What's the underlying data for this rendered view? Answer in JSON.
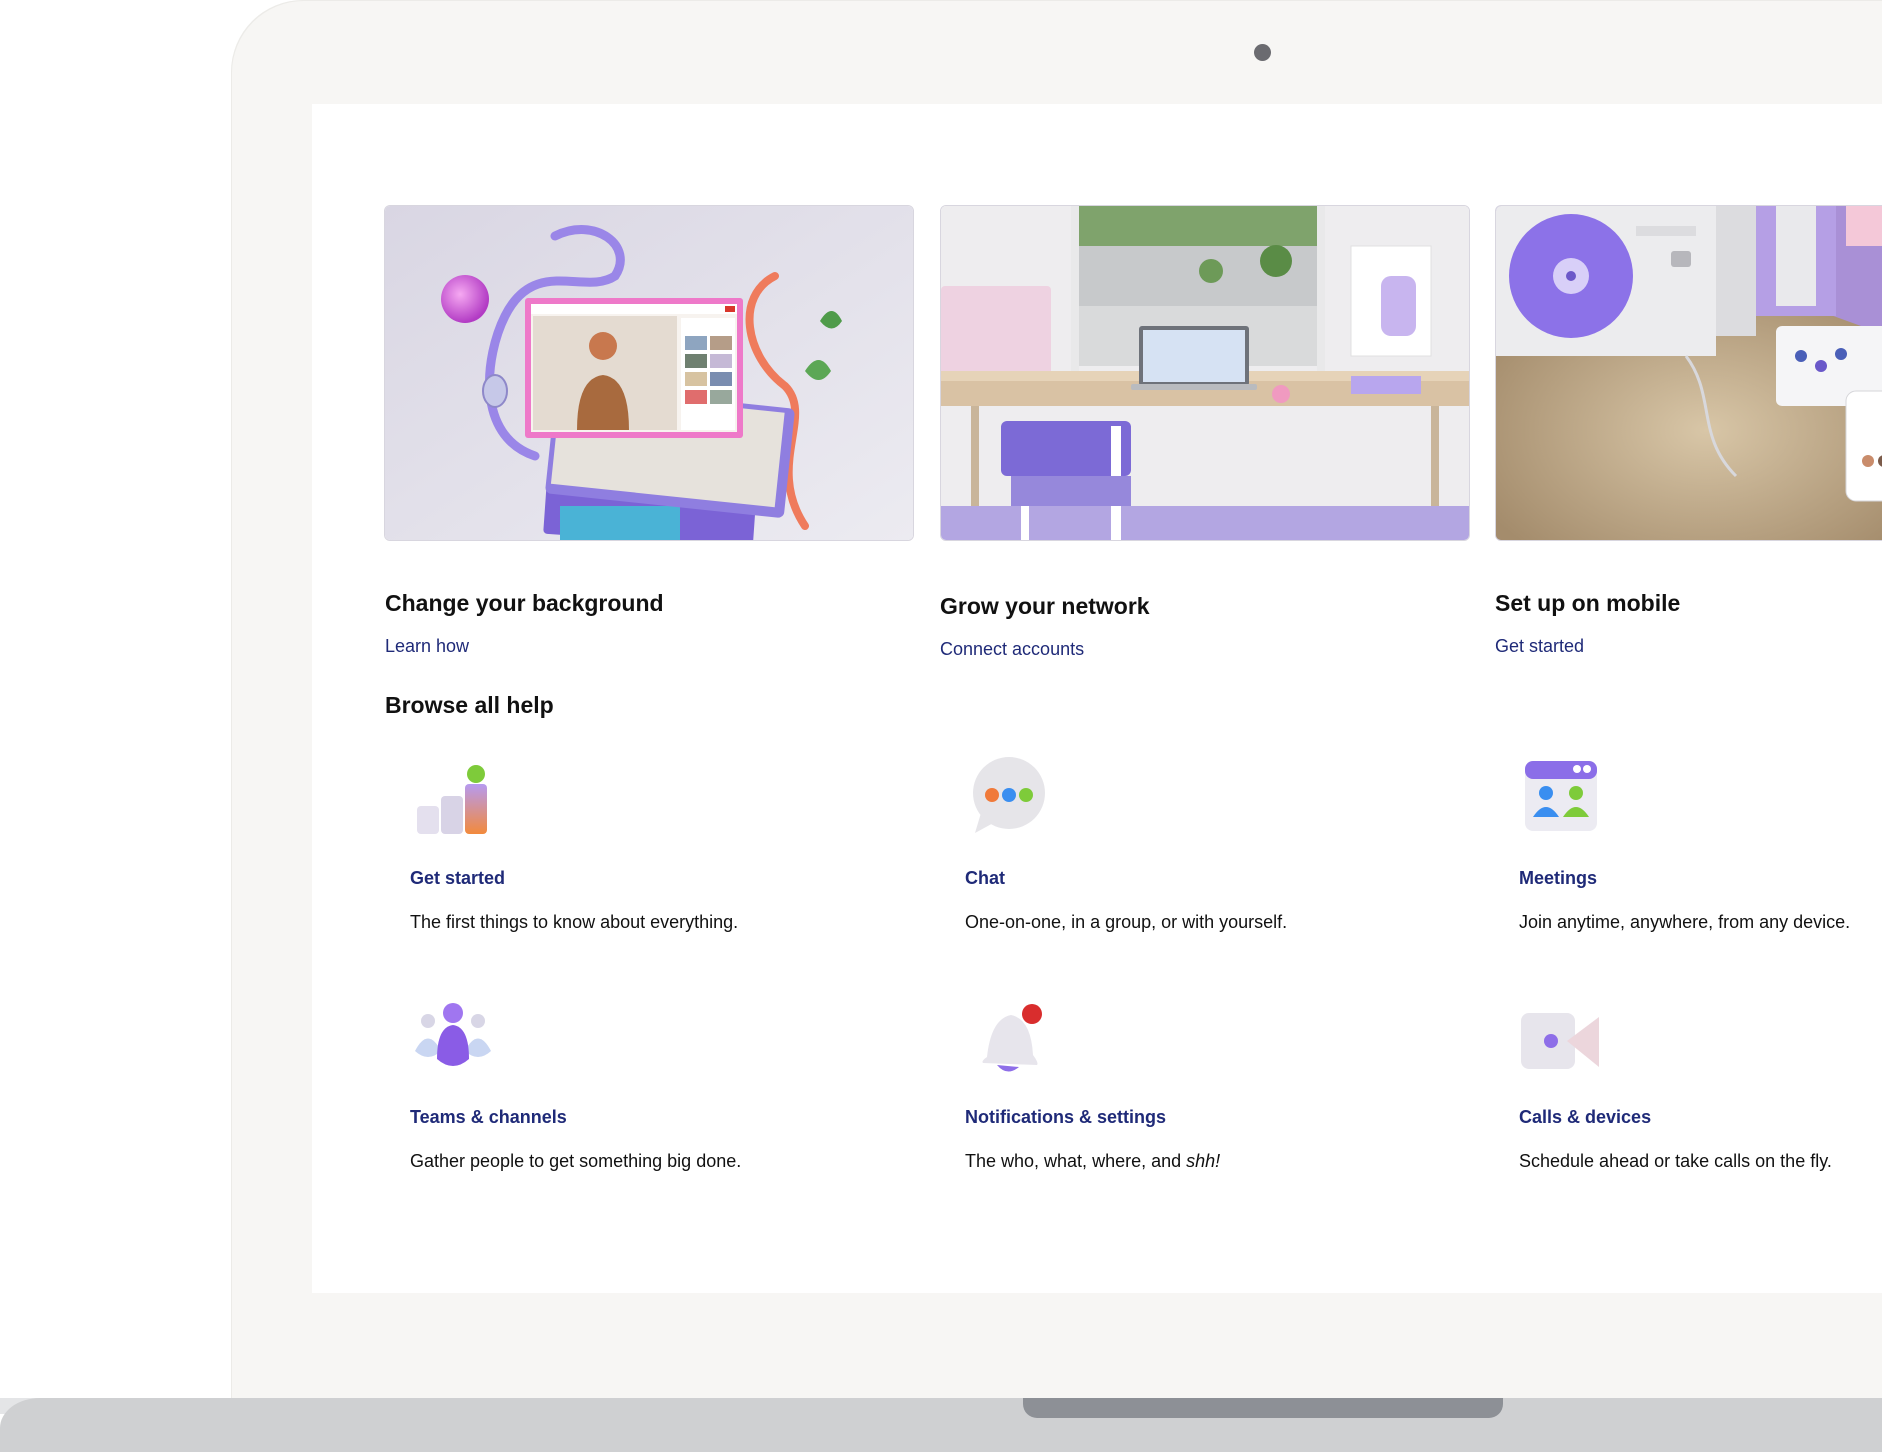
{
  "hero_cards": [
    {
      "title": "Change your background",
      "link": "Learn how"
    },
    {
      "title": "Grow your network",
      "link": "Connect accounts"
    },
    {
      "title": "Set up on mobile",
      "link": "Get started"
    }
  ],
  "browse": {
    "heading": "Browse all help",
    "items": [
      {
        "title": "Get started",
        "desc": "The first things to know about everything.",
        "icon": "bar-chart-icon"
      },
      {
        "title": "Chat",
        "desc": "One-on-one, in a group, or with yourself.",
        "icon": "chat-bubble-icon"
      },
      {
        "title": "Meetings",
        "desc": "Join anytime, anywhere, from any device.",
        "icon": "meeting-window-icon"
      },
      {
        "title": "Teams & channels",
        "desc": "Gather people to get something big done.",
        "icon": "people-group-icon"
      },
      {
        "title": "Notifications & settings",
        "desc_prefix": "The who, what, where, and ",
        "desc_em": "shh!",
        "icon": "bell-icon"
      },
      {
        "title": "Calls & devices",
        "desc": "Schedule ahead or take calls on the fly.",
        "icon": "video-camera-icon"
      }
    ]
  },
  "colors": {
    "link": "#1f2a78",
    "accent": "#7b68ee"
  }
}
